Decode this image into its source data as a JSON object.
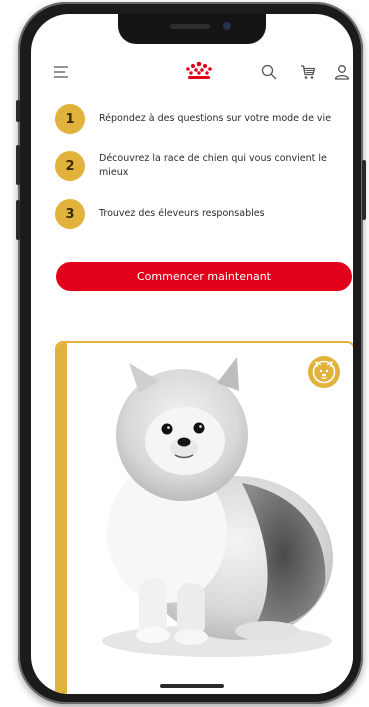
{
  "header": {
    "menu_icon": "hamburger-menu-icon",
    "logo_icon": "royal-canin-crown-logo",
    "search_icon": "search-icon",
    "cart_icon": "cart-icon",
    "account_icon": "user-icon"
  },
  "steps": [
    {
      "number": "1",
      "text": "Répondez à des questions sur votre mode de vie"
    },
    {
      "number": "2",
      "text": "Découvrez la race de chien qui vous convient le mieux"
    },
    {
      "number": "3",
      "text": "Trouvez des éleveurs responsables"
    }
  ],
  "cta": {
    "label": "Commencer maintenant"
  },
  "card": {
    "badge_icon": "dog-face-icon",
    "image": "pomeranian-dog-photo"
  },
  "colors": {
    "accent_red": "#e2001a",
    "gold": "#e2b33c"
  }
}
